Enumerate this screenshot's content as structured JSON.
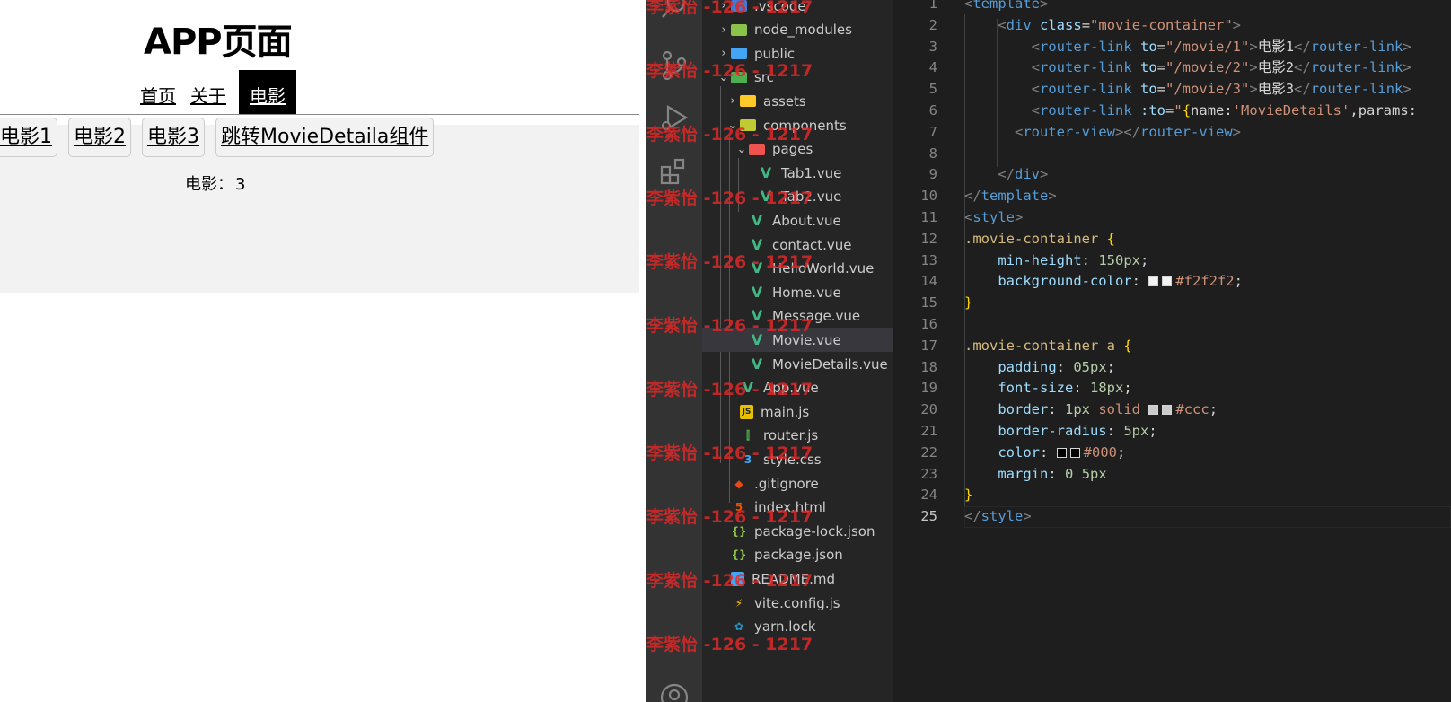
{
  "app": {
    "title": "APP页面",
    "nav": [
      {
        "label": "首页",
        "active": false
      },
      {
        "label": "关于",
        "active": false
      },
      {
        "label": "电影",
        "active": true
      }
    ],
    "movie_links": [
      "电影1",
      "电影2",
      "电影3",
      "跳转MovieDetaila组件"
    ],
    "movie_detail": {
      "label": "电影：",
      "value": "3"
    }
  },
  "explorer": {
    "items": [
      {
        "name": ".vscode",
        "type": "folder",
        "icon": "vscode-folder-icon",
        "depth": 1,
        "chevron": "›",
        "selected": false
      },
      {
        "name": "node_modules",
        "type": "folder",
        "icon": "node-folder-icon",
        "depth": 1,
        "chevron": "›",
        "selected": false
      },
      {
        "name": "public",
        "type": "folder",
        "icon": "public-folder-icon",
        "depth": 1,
        "chevron": "›",
        "selected": false
      },
      {
        "name": "src",
        "type": "folder",
        "icon": "src-folder-icon",
        "depth": 1,
        "chevron": "⌄",
        "selected": false
      },
      {
        "name": "assets",
        "type": "folder",
        "icon": "assets-folder-icon",
        "depth": 2,
        "chevron": "›",
        "selected": false
      },
      {
        "name": "components",
        "type": "folder",
        "icon": "components-folder-icon",
        "depth": 2,
        "chevron": "⌄",
        "selected": false
      },
      {
        "name": "pages",
        "type": "folder",
        "icon": "pages-folder-icon",
        "depth": 3,
        "chevron": "⌄",
        "selected": false
      },
      {
        "name": "Tab1.vue",
        "type": "vue",
        "icon": "vue-file-icon",
        "depth": 4,
        "chevron": "",
        "selected": false
      },
      {
        "name": "Tab2.vue",
        "type": "vue",
        "icon": "vue-file-icon",
        "depth": 4,
        "chevron": "",
        "selected": false
      },
      {
        "name": "About.vue",
        "type": "vue",
        "icon": "vue-file-icon",
        "depth": 3,
        "chevron": "",
        "selected": false
      },
      {
        "name": "contact.vue",
        "type": "vue",
        "icon": "vue-file-icon",
        "depth": 3,
        "chevron": "",
        "selected": false
      },
      {
        "name": "HelloWorld.vue",
        "type": "vue",
        "icon": "vue-file-icon",
        "depth": 3,
        "chevron": "",
        "selected": false
      },
      {
        "name": "Home.vue",
        "type": "vue",
        "icon": "vue-file-icon",
        "depth": 3,
        "chevron": "",
        "selected": false
      },
      {
        "name": "Message.vue",
        "type": "vue",
        "icon": "vue-file-icon",
        "depth": 3,
        "chevron": "",
        "selected": false
      },
      {
        "name": "Movie.vue",
        "type": "vue",
        "icon": "vue-file-icon",
        "depth": 3,
        "chevron": "",
        "selected": true
      },
      {
        "name": "MovieDetails.vue",
        "type": "vue",
        "icon": "vue-file-icon",
        "depth": 3,
        "chevron": "",
        "selected": false
      },
      {
        "name": "App.vue",
        "type": "vue",
        "icon": "vue-file-icon",
        "depth": 2,
        "chevron": "",
        "selected": false
      },
      {
        "name": "main.js",
        "type": "js",
        "icon": "js-file-icon",
        "depth": 2,
        "chevron": "",
        "selected": false
      },
      {
        "name": "router.js",
        "type": "router",
        "icon": "router-file-icon",
        "depth": 2,
        "chevron": "",
        "selected": false
      },
      {
        "name": "style.css",
        "type": "css",
        "icon": "css-file-icon",
        "depth": 2,
        "chevron": "",
        "selected": false
      },
      {
        "name": ".gitignore",
        "type": "git",
        "icon": "git-file-icon",
        "depth": 1,
        "chevron": "",
        "selected": false
      },
      {
        "name": "index.html",
        "type": "html",
        "icon": "html-file-icon",
        "depth": 1,
        "chevron": "",
        "selected": false
      },
      {
        "name": "package-lock.json",
        "type": "json",
        "icon": "json-file-icon",
        "depth": 1,
        "chevron": "",
        "selected": false
      },
      {
        "name": "package.json",
        "type": "json",
        "icon": "json-file-icon",
        "depth": 1,
        "chevron": "",
        "selected": false
      },
      {
        "name": "README.md",
        "type": "info",
        "icon": "info-file-icon",
        "depth": 1,
        "chevron": "",
        "selected": false
      },
      {
        "name": "vite.config.js",
        "type": "vite",
        "icon": "vite-file-icon",
        "depth": 1,
        "chevron": "",
        "selected": false
      },
      {
        "name": "yarn.lock",
        "type": "yarn",
        "icon": "yarn-file-icon",
        "depth": 1,
        "chevron": "",
        "selected": false
      }
    ]
  },
  "editor": {
    "current_line": 25,
    "lines": [
      [
        [
          "t-br",
          "<"
        ],
        [
          "t-tag",
          "template"
        ],
        [
          "t-br",
          ">"
        ]
      ],
      [
        [
          "t-txt",
          "    "
        ],
        [
          "t-br",
          "<"
        ],
        [
          "t-tag",
          "div"
        ],
        [
          "t-txt",
          " "
        ],
        [
          "t-attr",
          "class"
        ],
        [
          "t-punct",
          "="
        ],
        [
          "t-str",
          "\"movie-container\""
        ],
        [
          "t-br",
          ">"
        ]
      ],
      [
        [
          "t-txt",
          "        "
        ],
        [
          "t-br",
          "<"
        ],
        [
          "t-tag",
          "router-link"
        ],
        [
          "t-txt",
          " "
        ],
        [
          "t-attr",
          "to"
        ],
        [
          "t-punct",
          "="
        ],
        [
          "t-str",
          "\"/movie/1\""
        ],
        [
          "t-br",
          ">"
        ],
        [
          "t-txt",
          "电影1"
        ],
        [
          "t-br",
          "</"
        ],
        [
          "t-tag",
          "router-link"
        ],
        [
          "t-br",
          ">"
        ]
      ],
      [
        [
          "t-txt",
          "        "
        ],
        [
          "t-br",
          "<"
        ],
        [
          "t-tag",
          "router-link"
        ],
        [
          "t-txt",
          " "
        ],
        [
          "t-attr",
          "to"
        ],
        [
          "t-punct",
          "="
        ],
        [
          "t-str",
          "\"/movie/2\""
        ],
        [
          "t-br",
          ">"
        ],
        [
          "t-txt",
          "电影2"
        ],
        [
          "t-br",
          "</"
        ],
        [
          "t-tag",
          "router-link"
        ],
        [
          "t-br",
          ">"
        ]
      ],
      [
        [
          "t-txt",
          "        "
        ],
        [
          "t-br",
          "<"
        ],
        [
          "t-tag",
          "router-link"
        ],
        [
          "t-txt",
          " "
        ],
        [
          "t-attr",
          "to"
        ],
        [
          "t-punct",
          "="
        ],
        [
          "t-str",
          "\"/movie/3\""
        ],
        [
          "t-br",
          ">"
        ],
        [
          "t-txt",
          "电影3"
        ],
        [
          "t-br",
          "</"
        ],
        [
          "t-tag",
          "router-link"
        ],
        [
          "t-br",
          ">"
        ]
      ],
      [
        [
          "t-txt",
          "        "
        ],
        [
          "t-br",
          "<"
        ],
        [
          "t-tag",
          "router-link"
        ],
        [
          "t-txt",
          " "
        ],
        [
          "t-attr",
          ":to"
        ],
        [
          "t-punct",
          "="
        ],
        [
          "t-str",
          "\""
        ],
        [
          "t-brace",
          "{"
        ],
        [
          "t-txt",
          "name:"
        ],
        [
          "t-str",
          "'MovieDetails'"
        ],
        [
          "t-txt",
          ",params:"
        ]
      ],
      [
        [
          "t-txt",
          "      "
        ],
        [
          "t-br",
          "<"
        ],
        [
          "t-tag",
          "router-view"
        ],
        [
          "t-br",
          "></"
        ],
        [
          "t-tag",
          "router-view"
        ],
        [
          "t-br",
          ">"
        ]
      ],
      [],
      [
        [
          "t-txt",
          "    "
        ],
        [
          "t-br",
          "</"
        ],
        [
          "t-tag",
          "div"
        ],
        [
          "t-br",
          ">"
        ]
      ],
      [
        [
          "t-br",
          "</"
        ],
        [
          "t-tag",
          "template"
        ],
        [
          "t-br",
          ">"
        ]
      ],
      [
        [
          "t-br",
          "<"
        ],
        [
          "t-tag",
          "style"
        ],
        [
          "t-br",
          ">"
        ]
      ],
      [
        [
          "t-sel",
          ".movie-container"
        ],
        [
          "t-txt",
          " "
        ],
        [
          "t-brace",
          "{"
        ]
      ],
      [
        [
          "t-txt",
          "    "
        ],
        [
          "t-prop",
          "min-height"
        ],
        [
          "t-punct",
          ": "
        ],
        [
          "t-num",
          "150px"
        ],
        [
          "t-punct",
          ";"
        ]
      ],
      [
        [
          "t-txt",
          "    "
        ],
        [
          "t-prop",
          "background-color"
        ],
        [
          "t-punct",
          ": "
        ],
        [
          "swatch",
          "#f2f2f2"
        ],
        [
          "swatch",
          "#f2f2f2"
        ],
        [
          "t-kw",
          "#f2f2f2"
        ],
        [
          "t-punct",
          ";"
        ]
      ],
      [
        [
          "t-brace",
          "}"
        ]
      ],
      [],
      [
        [
          "t-sel",
          ".movie-container a"
        ],
        [
          "t-txt",
          " "
        ],
        [
          "t-brace",
          "{"
        ]
      ],
      [
        [
          "t-txt",
          "    "
        ],
        [
          "t-prop",
          "padding"
        ],
        [
          "t-punct",
          ": "
        ],
        [
          "t-num",
          "05px"
        ],
        [
          "t-punct",
          ";"
        ]
      ],
      [
        [
          "t-txt",
          "    "
        ],
        [
          "t-prop",
          "font-size"
        ],
        [
          "t-punct",
          ": "
        ],
        [
          "t-num",
          "18px"
        ],
        [
          "t-punct",
          ";"
        ]
      ],
      [
        [
          "t-txt",
          "    "
        ],
        [
          "t-prop",
          "border"
        ],
        [
          "t-punct",
          ": "
        ],
        [
          "t-num",
          "1px"
        ],
        [
          "t-txt",
          " "
        ],
        [
          "t-kw",
          "solid"
        ],
        [
          "t-txt",
          " "
        ],
        [
          "swatch",
          "#cccccc"
        ],
        [
          "swatch",
          "#cccccc"
        ],
        [
          "t-kw",
          "#ccc"
        ],
        [
          "t-punct",
          ";"
        ]
      ],
      [
        [
          "t-txt",
          "    "
        ],
        [
          "t-prop",
          "border-radius"
        ],
        [
          "t-punct",
          ": "
        ],
        [
          "t-num",
          "5px"
        ],
        [
          "t-punct",
          ";"
        ]
      ],
      [
        [
          "t-txt",
          "    "
        ],
        [
          "t-prop",
          "color"
        ],
        [
          "t-punct",
          ": "
        ],
        [
          "swatch",
          "#000000"
        ],
        [
          "swatch",
          "#000000"
        ],
        [
          "t-kw",
          "#000"
        ],
        [
          "t-punct",
          ";"
        ]
      ],
      [
        [
          "t-txt",
          "    "
        ],
        [
          "t-prop",
          "margin"
        ],
        [
          "t-punct",
          ": "
        ],
        [
          "t-num",
          "0"
        ],
        [
          "t-txt",
          " "
        ],
        [
          "t-num",
          "5px"
        ]
      ],
      [
        [
          "t-brace",
          "}"
        ]
      ],
      [
        [
          "t-br",
          "</"
        ],
        [
          "t-tag",
          "style"
        ],
        [
          "t-br",
          ">"
        ]
      ]
    ]
  },
  "watermark": {
    "text": "李紫怡 -126 - 1217"
  },
  "colors": {
    "accent": "#000000",
    "container_bg": "#f2f2f2",
    "vue_green": "#41b883",
    "editor_bg": "#1e1e1e"
  }
}
